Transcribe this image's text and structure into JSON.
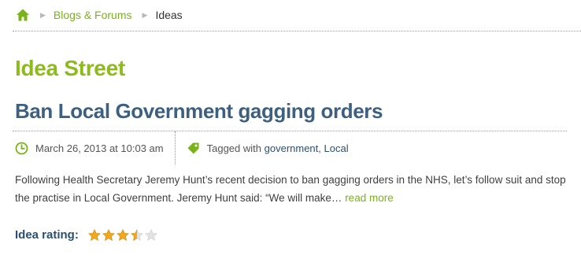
{
  "breadcrumb": {
    "home_icon": "home-icon",
    "separator_icon": "triangle-right-icon",
    "items": [
      {
        "label": "Blogs & Forums"
      },
      {
        "label": "Ideas"
      }
    ]
  },
  "section_title": "Idea Street",
  "post": {
    "title": "Ban Local Government gagging orders",
    "date": "March 26, 2013 at 10:03 am",
    "date_icon": "clock-icon",
    "tag_icon": "tag-icon",
    "tagged_prefix": "Tagged with",
    "tags": [
      "government",
      "Local"
    ],
    "tag_separator": ",",
    "excerpt": "Following Health Secretary Jeremy Hunt’s recent decision to ban gagging orders in the NHS, let’s follow suit and stop the practise in Local Government. Jeremy Hunt said: “We will make…",
    "read_more": "read more"
  },
  "rating": {
    "label": "Idea rating:",
    "value": 3.5,
    "max": 5,
    "star_icon": "star-icon"
  },
  "colors": {
    "accent_green": "#7ab317",
    "heading_green": "#8dbb1b",
    "title_blue": "#3d5f80",
    "link_blue": "#2c4f6e",
    "star_gold": "#f2a81d",
    "star_empty": "#e2e2e2"
  }
}
